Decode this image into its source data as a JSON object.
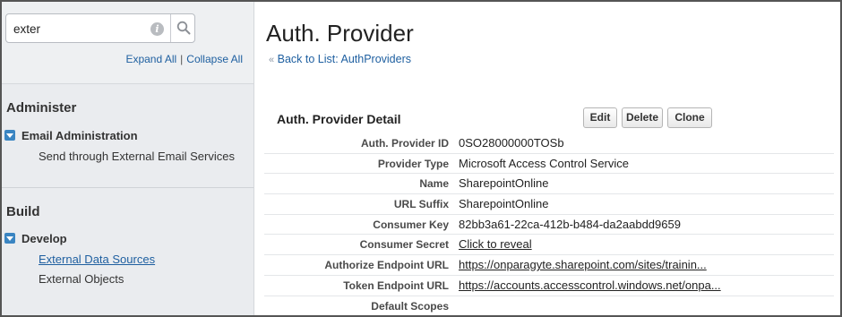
{
  "sidebar": {
    "search": {
      "value": "exter",
      "placeholder": ""
    },
    "expand_all": "Expand All",
    "separator": "|",
    "collapse_all": "Collapse All",
    "sections": [
      {
        "title": "Administer",
        "group": "Email Administration",
        "items": [
          "Send through External Email Services"
        ]
      },
      {
        "title": "Build",
        "group": "Develop",
        "items": [
          "External Data Sources",
          "External Objects"
        ]
      }
    ]
  },
  "main": {
    "title": "Auth. Provider",
    "back_prefix": "«",
    "back_link": "Back to List: AuthProviders",
    "detail_title": "Auth. Provider Detail",
    "buttons": {
      "edit": "Edit",
      "delete": "Delete",
      "clone": "Clone"
    },
    "fields": [
      {
        "label": "Auth. Provider ID",
        "value": "0SO28000000TOSb"
      },
      {
        "label": "Provider Type",
        "value": "Microsoft Access Control Service"
      },
      {
        "label": "Name",
        "value": "SharepointOnline"
      },
      {
        "label": "URL Suffix",
        "value": "SharepointOnline"
      },
      {
        "label": "Consumer Key",
        "value": "82bb3a61-22ca-412b-b484-da2aabdd9659"
      },
      {
        "label": "Consumer Secret",
        "value": "Click to reveal"
      },
      {
        "label": "Authorize Endpoint URL",
        "value": "https://onparagyte.sharepoint.com/sites/trainin..."
      },
      {
        "label": "Token Endpoint URL",
        "value": "https://accounts.accesscontrol.windows.net/onpa..."
      },
      {
        "label": "Default Scopes",
        "value": ""
      }
    ]
  },
  "colors": {
    "link": "#1e5fa0",
    "expander": "#3a85c2",
    "sidebar_bg": "#eaecef"
  }
}
